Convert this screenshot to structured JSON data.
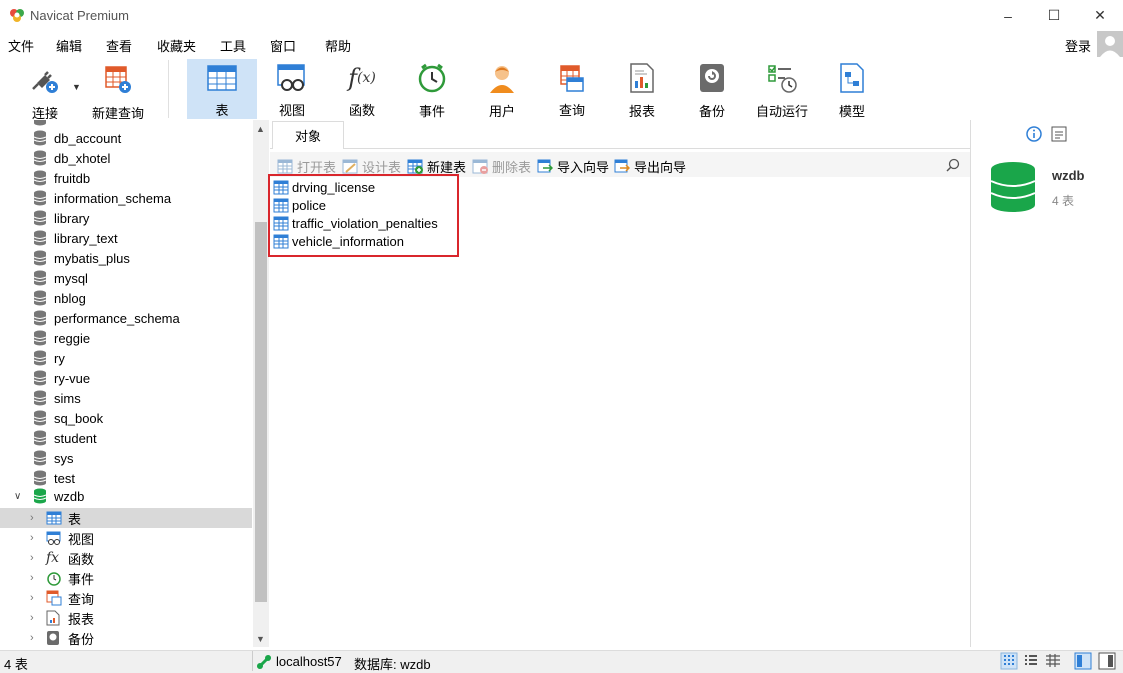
{
  "app": {
    "title": "Navicat Premium"
  },
  "menu": [
    "文件",
    "编辑",
    "查看",
    "收藏夹",
    "工具",
    "窗口",
    "帮助"
  ],
  "login_label": "登录",
  "toolbar": {
    "connect": "连接",
    "new_query": "新建查询",
    "buttons": [
      "表",
      "视图",
      "函数",
      "事件",
      "用户",
      "查询",
      "报表",
      "备份",
      "自动运行",
      "模型"
    ]
  },
  "tree": {
    "databases": [
      "db_account",
      "db_xhotel",
      "fruitdb",
      "information_schema",
      "library",
      "library_text",
      "mybatis_plus",
      "mysql",
      "nblog",
      "performance_schema",
      "reggie",
      "ry",
      "ry-vue",
      "sims",
      "sq_book",
      "student",
      "sys",
      "test"
    ],
    "open_db": "wzdb",
    "children": [
      "表",
      "视图",
      "函数",
      "事件",
      "查询",
      "报表",
      "备份"
    ]
  },
  "tabs": {
    "objects": "对象"
  },
  "object_toolbar": {
    "open": "打开表",
    "design": "设计表",
    "new": "新建表",
    "delete": "删除表",
    "import": "导入向导",
    "export": "导出向导"
  },
  "tables": [
    "drving_license",
    "police",
    "traffic_violation_penalties",
    "vehicle_information"
  ],
  "right_panel": {
    "name": "wzdb",
    "count": "4 表"
  },
  "status": {
    "count": "4 表",
    "connection": "localhost57",
    "database": "数据库: wzdb"
  },
  "colors": {
    "accent": "#cfe3f7",
    "highlight": "#d9262c",
    "db_green": "#1aa64a"
  }
}
